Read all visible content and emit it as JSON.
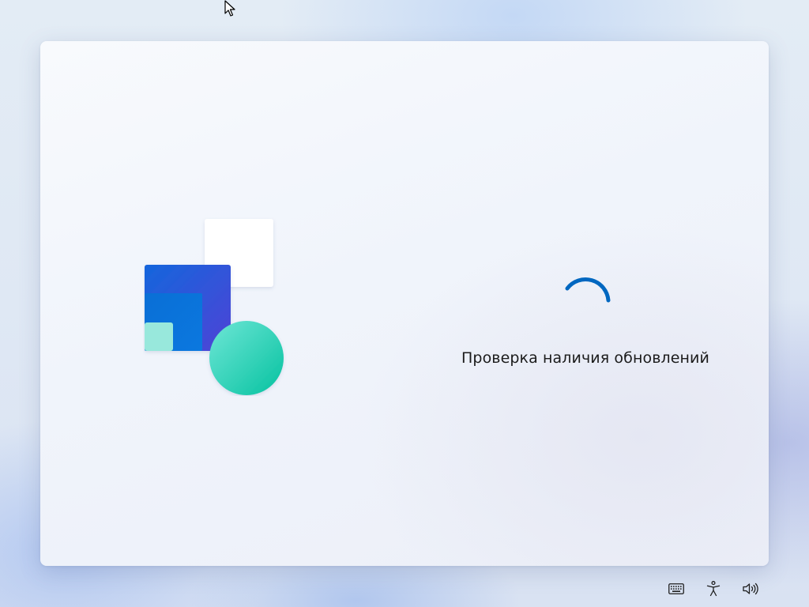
{
  "setup": {
    "status_text": "Проверка наличия обновлений"
  },
  "icons": {
    "cursor": "mouse-pointer-icon",
    "logo": "windows-setup-illustration-icon",
    "spinner": "loading-spinner-icon",
    "keyboard": "keyboard-icon",
    "accessibility": "accessibility-icon",
    "volume": "volume-icon"
  },
  "colors": {
    "accent": "#0067c0",
    "logo_blue": "#1a64d8",
    "logo_indigo": "#4a45d8",
    "logo_teal": "#2dd4b8",
    "text": "#1b1b1b"
  }
}
